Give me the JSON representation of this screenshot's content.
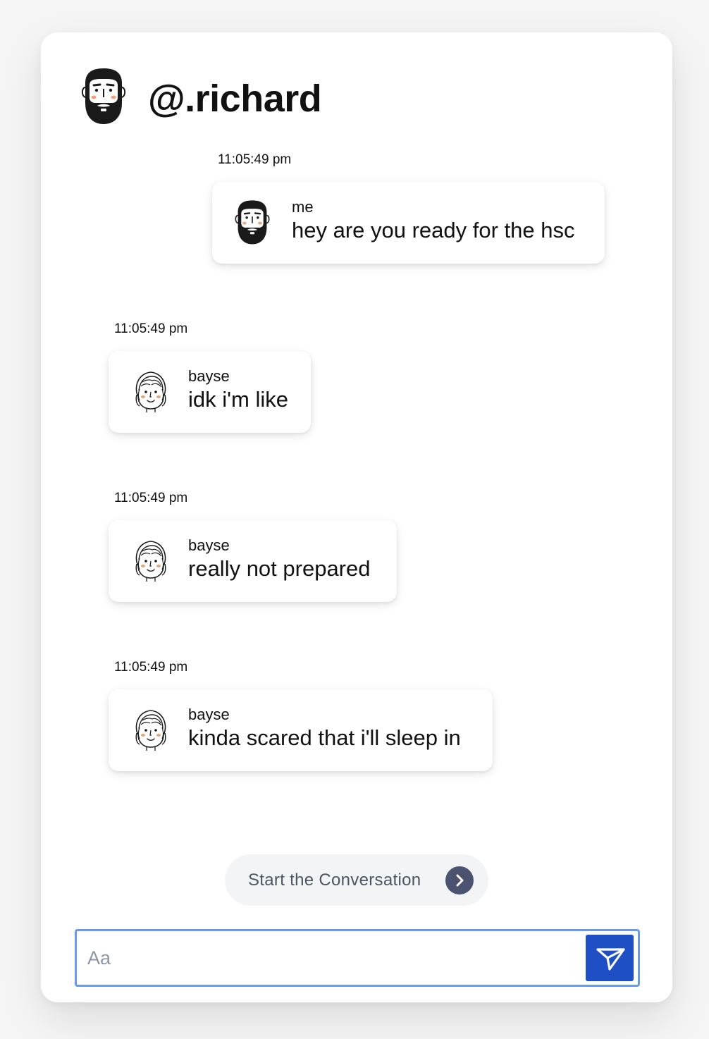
{
  "header": {
    "title": "@.richard",
    "avatar_icon": "bearded-man-avatar-icon"
  },
  "messages": [
    {
      "timestamp": "11:05:49 pm",
      "sender": "me",
      "text": "hey are you ready for the hsc",
      "avatar_icon": "bearded-man-avatar-icon"
    },
    {
      "timestamp": "11:05:49 pm",
      "sender": "bayse",
      "text": "idk i'm like",
      "avatar_icon": "woman-avatar-icon"
    },
    {
      "timestamp": "11:05:49 pm",
      "sender": "bayse",
      "text": "really not prepared",
      "avatar_icon": "woman-avatar-icon"
    },
    {
      "timestamp": "11:05:49 pm",
      "sender": "bayse",
      "text": "kinda scared that i'll sleep in",
      "avatar_icon": "woman-avatar-icon"
    }
  ],
  "start_button": {
    "label": "Start the Conversation",
    "icon": "chevron-right-icon"
  },
  "composer": {
    "placeholder": "Aa",
    "value": "",
    "send_icon": "send-icon"
  },
  "colors": {
    "send_button": "#1e4fc4",
    "input_border": "#6b9be6",
    "start_button_bg": "#f3f4f6",
    "chevron_bg": "#4b5370",
    "cheek": "#f0a277"
  }
}
